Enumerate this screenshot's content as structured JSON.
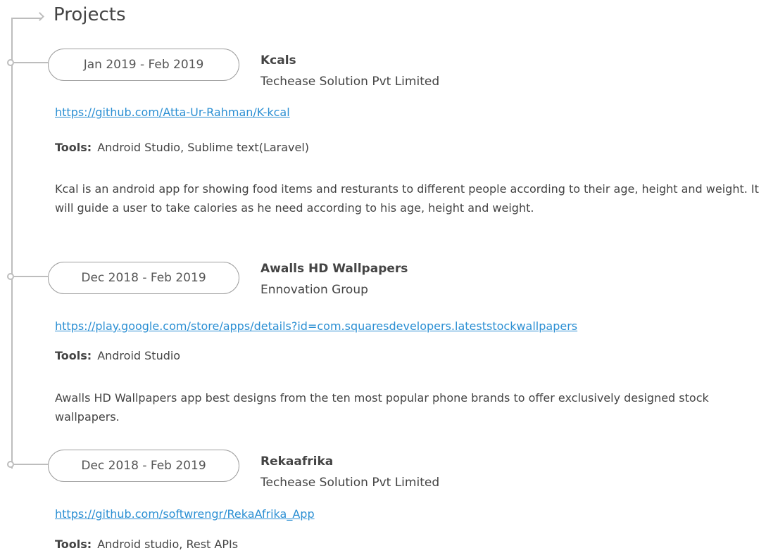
{
  "section": {
    "title": "Projects"
  },
  "tools_label": "Tools:",
  "projects": [
    {
      "date": "Jan 2019 - Feb 2019",
      "name": "Kcals",
      "org": "Techease Solution Pvt Limited",
      "link": "https://github.com/Atta-Ur-Rahman/K-kcal",
      "tools": "Android Studio, Sublime text(Laravel)",
      "description": "Kcal is an android app for showing food items and resturants to different people according to their age, height and weight. It will guide a user to take calories as he need according to his age, height and weight."
    },
    {
      "date": "Dec 2018 - Feb 2019",
      "name": "Awalls HD Wallpapers",
      "org": "Ennovation Group",
      "link": "https://play.google.com/store/apps/details?id=com.squaresdevelopers.lateststockwallpapers",
      "tools": "Android Studio",
      "description": "Awalls HD Wallpapers app best designs from the ten most popular phone brands to offer exclusively designed stock wallpapers."
    },
    {
      "date": "Dec 2018 - Feb 2019",
      "name": "Rekaafrika",
      "org": "Techease Solution Pvt Limited",
      "link": "https://github.com/softwrengr/RekaAfrika_App",
      "tools": "Android studio, Rest APIs"
    }
  ]
}
